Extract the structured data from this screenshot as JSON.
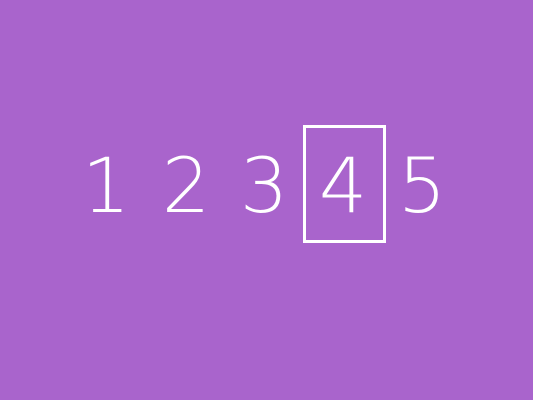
{
  "background_color": "#a964cc",
  "digit_color": "#ffffff",
  "digits": [
    "1",
    "2",
    "3",
    "4",
    "5"
  ],
  "selected_digit": "4"
}
